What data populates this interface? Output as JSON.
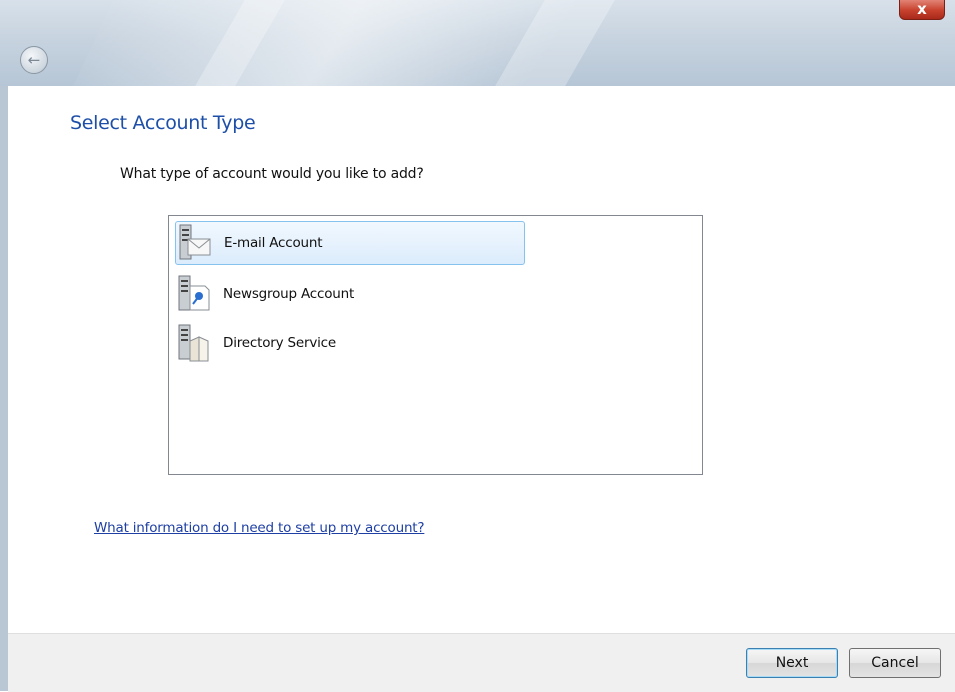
{
  "header": {
    "title": "Select Account Type",
    "question": "What type of account would you like to add?"
  },
  "account_types": [
    {
      "label": "E-mail Account",
      "icon": "email-account-icon",
      "selected": true
    },
    {
      "label": "Newsgroup Account",
      "icon": "newsgroup-account-icon",
      "selected": false
    },
    {
      "label": "Directory Service",
      "icon": "directory-service-icon",
      "selected": false
    }
  ],
  "help_link": "What information do I need to set up my account?",
  "buttons": {
    "next": "Next",
    "cancel": "Cancel"
  },
  "window": {
    "close_glyph": "x",
    "back_glyph": "←"
  },
  "colors": {
    "title": "#1e4fa8",
    "link": "#1e3fa3",
    "selection": "#dcecfc",
    "close_button": "#c8432f"
  }
}
